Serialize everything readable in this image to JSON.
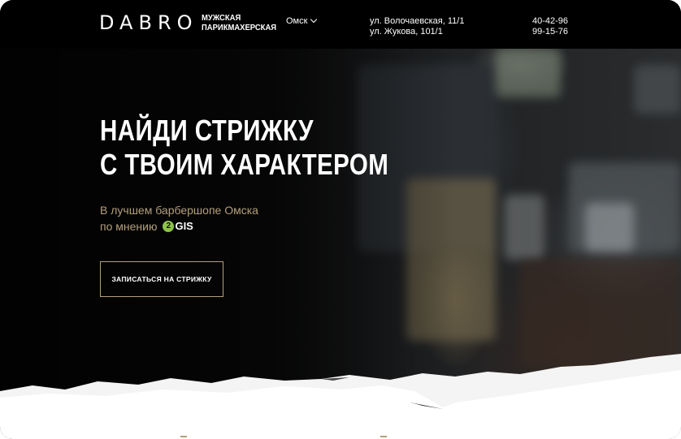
{
  "header": {
    "logo_mark": "DABRO",
    "logo_text_line1": "МУЖСКАЯ",
    "logo_text_line2": "ПАРИКМАХЕРСКАЯ",
    "city": "Омск",
    "addresses": [
      "ул. Волочаевская, 11/1",
      "ул. Жукова, 101/1"
    ],
    "phones": [
      "40-42-96",
      "99-15-76"
    ]
  },
  "hero": {
    "headline_line1": "НАЙДИ СТРИЖКУ",
    "headline_line2": "С ТВОИМ ХАРАКТЕРОМ",
    "subtitle_line1": "В лучшем барбершопе Омска",
    "subtitle_line2": "по мнению",
    "badge_icon": "2gis-logo",
    "badge_digit": "2",
    "badge_text": "GIS",
    "cta_label": "ЗАПИСАТЬСЯ НА СТРИЖКУ"
  },
  "colors": {
    "accent": "#b49f7a",
    "header_bg": "#000000",
    "gis_green": "#8bc34a"
  }
}
